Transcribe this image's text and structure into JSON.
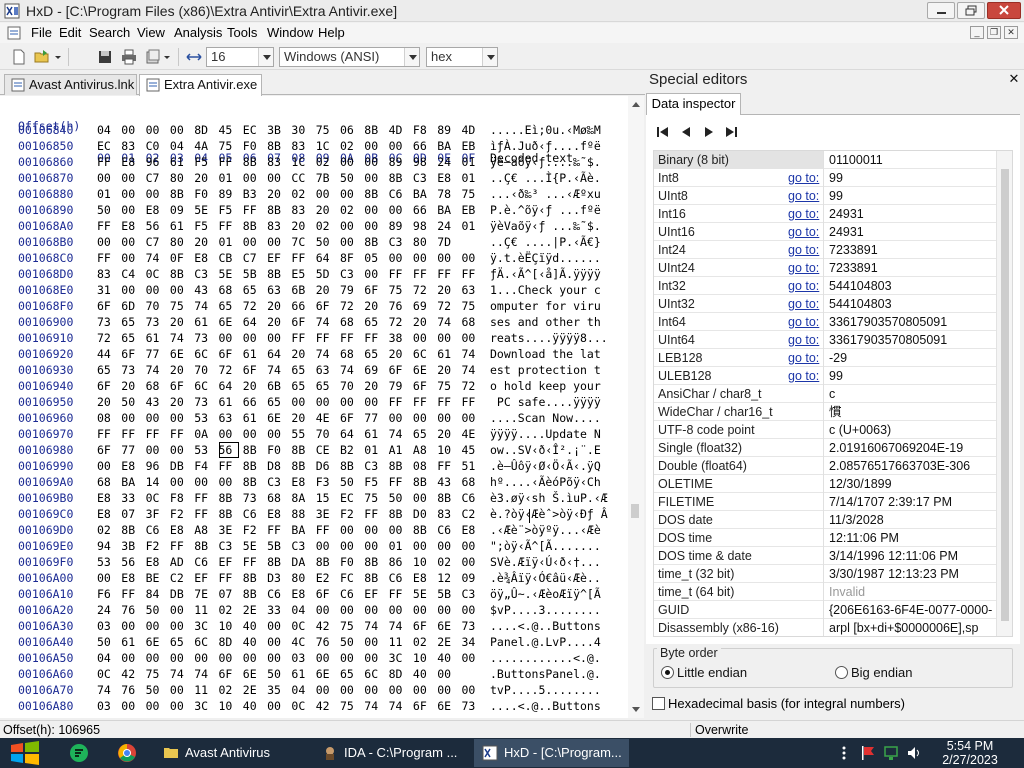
{
  "window": {
    "title": "HxD - [C:\\Program Files (x86)\\Extra Antivir\\Extra Antivir.exe]"
  },
  "menu": [
    "File",
    "Edit",
    "Search",
    "View",
    "Analysis",
    "Tools",
    "Window",
    "Help"
  ],
  "toolbar": {
    "bytes_per_row": "16",
    "charset": "Windows (ANSI)",
    "base": "hex"
  },
  "tabs": [
    {
      "label": "Avast Antivirus.lnk",
      "active": false
    },
    {
      "label": "Extra Antivir.exe",
      "active": true
    }
  ],
  "hex": {
    "offset_header": "Offset(h)",
    "column_headers": [
      "00",
      "01",
      "02",
      "03",
      "04",
      "05",
      "06",
      "07",
      "08",
      "09",
      "0A",
      "0B",
      "0C",
      "0D",
      "0E",
      "0F"
    ],
    "text_header": "Decoded text",
    "selected_cell": {
      "row": 20,
      "col": 5
    },
    "rows": [
      {
        "offset": "00106840",
        "bytes": [
          "04",
          "00",
          "00",
          "00",
          "8D",
          "45",
          "EC",
          "3B",
          "30",
          "75",
          "06",
          "8B",
          "4D",
          "F8",
          "89",
          "4D"
        ],
        "text": ".....Eì;0u.‹Mø‰M"
      },
      {
        "offset": "00106850",
        "bytes": [
          "EC",
          "83",
          "C0",
          "04",
          "4A",
          "75",
          "F0",
          "8B",
          "83",
          "1C",
          "02",
          "00",
          "00",
          "66",
          "BA",
          "EB"
        ],
        "text": "ìƒÀ.Juð‹ƒ....fºë"
      },
      {
        "offset": "00106860",
        "bytes": [
          "FF",
          "E8",
          "96",
          "61",
          "F5",
          "FF",
          "8B",
          "83",
          "1C",
          "02",
          "00",
          "00",
          "89",
          "98",
          "24",
          "01"
        ],
        "text": "ÿè–aõÿ‹ƒ....‰˜$."
      },
      {
        "offset": "00106870",
        "bytes": [
          "00",
          "00",
          "C7",
          "80",
          "20",
          "01",
          "00",
          "00",
          "CC",
          "7B",
          "50",
          "00",
          "8B",
          "C3",
          "E8",
          "01"
        ],
        "text": "..Ç€ ...Ì{P.‹Ãè."
      },
      {
        "offset": "00106880",
        "bytes": [
          "01",
          "00",
          "00",
          "8B",
          "F0",
          "89",
          "B3",
          "20",
          "02",
          "00",
          "00",
          "8B",
          "C6",
          "BA",
          "78",
          "75"
        ],
        "text": "...‹ð‰³ ...‹Æºxu"
      },
      {
        "offset": "00106890",
        "bytes": [
          "50",
          "00",
          "E8",
          "09",
          "5E",
          "F5",
          "FF",
          "8B",
          "83",
          "20",
          "02",
          "00",
          "00",
          "66",
          "BA",
          "EB"
        ],
        "text": "P.è.^õÿ‹ƒ ...fºë"
      },
      {
        "offset": "001068A0",
        "bytes": [
          "FF",
          "E8",
          "56",
          "61",
          "F5",
          "FF",
          "8B",
          "83",
          "20",
          "02",
          "00",
          "00",
          "89",
          "98",
          "24",
          "01"
        ],
        "text": "ÿèVaõÿ‹ƒ ...‰˜$."
      },
      {
        "offset": "001068B0",
        "bytes": [
          "00",
          "00",
          "C7",
          "80",
          "20",
          "01",
          "00",
          "00",
          "7C",
          "50",
          "00",
          "8B",
          "C3",
          "80",
          "7D"
        ],
        "text": "..Ç€ ....|P.‹Ã€}"
      },
      {
        "offset": "001068C0",
        "bytes": [
          "FF",
          "00",
          "74",
          "0F",
          "E8",
          "CB",
          "C7",
          "EF",
          "FF",
          "64",
          "8F",
          "05",
          "00",
          "00",
          "00",
          "00"
        ],
        "text": "ÿ.t.èËÇïÿd......"
      },
      {
        "offset": "001068D0",
        "bytes": [
          "83",
          "C4",
          "0C",
          "8B",
          "C3",
          "5E",
          "5B",
          "8B",
          "E5",
          "5D",
          "C3",
          "00",
          "FF",
          "FF",
          "FF",
          "FF"
        ],
        "text": "ƒÄ.‹Ã^[‹å]Ã.ÿÿÿÿ"
      },
      {
        "offset": "001068E0",
        "bytes": [
          "31",
          "00",
          "00",
          "00",
          "43",
          "68",
          "65",
          "63",
          "6B",
          "20",
          "79",
          "6F",
          "75",
          "72",
          "20",
          "63"
        ],
        "text": "1...Check your c"
      },
      {
        "offset": "001068F0",
        "bytes": [
          "6F",
          "6D",
          "70",
          "75",
          "74",
          "65",
          "72",
          "20",
          "66",
          "6F",
          "72",
          "20",
          "76",
          "69",
          "72",
          "75"
        ],
        "text": "omputer for viru"
      },
      {
        "offset": "00106900",
        "bytes": [
          "73",
          "65",
          "73",
          "20",
          "61",
          "6E",
          "64",
          "20",
          "6F",
          "74",
          "68",
          "65",
          "72",
          "20",
          "74",
          "68"
        ],
        "text": "ses and other th"
      },
      {
        "offset": "00106910",
        "bytes": [
          "72",
          "65",
          "61",
          "74",
          "73",
          "00",
          "00",
          "00",
          "FF",
          "FF",
          "FF",
          "FF",
          "38",
          "00",
          "00",
          "00"
        ],
        "text": "reats....ÿÿÿÿ8..."
      },
      {
        "offset": "00106920",
        "bytes": [
          "44",
          "6F",
          "77",
          "6E",
          "6C",
          "6F",
          "61",
          "64",
          "20",
          "74",
          "68",
          "65",
          "20",
          "6C",
          "61",
          "74"
        ],
        "text": "Download the lat"
      },
      {
        "offset": "00106930",
        "bytes": [
          "65",
          "73",
          "74",
          "20",
          "70",
          "72",
          "6F",
          "74",
          "65",
          "63",
          "74",
          "69",
          "6F",
          "6E",
          "20",
          "74"
        ],
        "text": "est protection t"
      },
      {
        "offset": "00106940",
        "bytes": [
          "6F",
          "20",
          "68",
          "6F",
          "6C",
          "64",
          "20",
          "6B",
          "65",
          "65",
          "70",
          "20",
          "79",
          "6F",
          "75",
          "72"
        ],
        "text": "o hold keep your"
      },
      {
        "offset": "00106950",
        "bytes": [
          "20",
          "50",
          "43",
          "20",
          "73",
          "61",
          "66",
          "65",
          "00",
          "00",
          "00",
          "00",
          "FF",
          "FF",
          "FF",
          "FF"
        ],
        "text": " PC safe....ÿÿÿÿ"
      },
      {
        "offset": "00106960",
        "bytes": [
          "08",
          "00",
          "00",
          "00",
          "53",
          "63",
          "61",
          "6E",
          "20",
          "4E",
          "6F",
          "77",
          "00",
          "00",
          "00",
          "00"
        ],
        "text": "....Scan Now...."
      },
      {
        "offset": "00106970",
        "bytes": [
          "FF",
          "FF",
          "FF",
          "FF",
          "0A",
          "00",
          "00",
          "00",
          "55",
          "70",
          "64",
          "61",
          "74",
          "65",
          "20",
          "4E"
        ],
        "text": "ÿÿÿÿ....Update N"
      },
      {
        "offset": "00106980",
        "bytes": [
          "6F",
          "77",
          "00",
          "00",
          "53",
          "56",
          "8B",
          "F0",
          "8B",
          "CE",
          "B2",
          "01",
          "A1",
          "A8",
          "10",
          "45"
        ],
        "text": "ow..SV‹ð‹Î².¡¨.E"
      },
      {
        "offset": "00106990",
        "bytes": [
          "00",
          "E8",
          "96",
          "DB",
          "F4",
          "FF",
          "8B",
          "D8",
          "8B",
          "D6",
          "8B",
          "C3",
          "8B",
          "08",
          "FF",
          "51"
        ],
        "text": ".è–Ûôÿ‹Ø‹Ö‹Ã‹.ÿQ"
      },
      {
        "offset": "001069A0",
        "bytes": [
          "68",
          "BA",
          "14",
          "00",
          "00",
          "00",
          "8B",
          "C3",
          "E8",
          "F3",
          "50",
          "F5",
          "FF",
          "8B",
          "43",
          "68"
        ],
        "text": "hº....‹ÃèóPõÿ‹Ch"
      },
      {
        "offset": "001069B0",
        "bytes": [
          "E8",
          "33",
          "0C",
          "F8",
          "FF",
          "8B",
          "73",
          "68",
          "8A",
          "15",
          "EC",
          "75",
          "50",
          "00",
          "8B",
          "C6"
        ],
        "text": "è3.øÿ‹sh Š.ìuP.‹Æ"
      },
      {
        "offset": "001069C0",
        "bytes": [
          "E8",
          "07",
          "3F",
          "F2",
          "FF",
          "8B",
          "C6",
          "E8",
          "88",
          "3E",
          "F2",
          "FF",
          "8B",
          "D0",
          "83",
          "C2"
        ],
        "text": "è.?òÿ‹Æèˆ>òÿ‹Ðƒ Â"
      },
      {
        "offset": "001069D0",
        "bytes": [
          "02",
          "8B",
          "C6",
          "E8",
          "A8",
          "3E",
          "F2",
          "FF",
          "BA",
          "FF",
          "00",
          "00",
          "00",
          "8B",
          "C6",
          "E8"
        ],
        "text": ".‹Æè¨>òÿºÿ...‹Æè"
      },
      {
        "offset": "001069E0",
        "bytes": [
          "94",
          "3B",
          "F2",
          "FF",
          "8B",
          "C3",
          "5E",
          "5B",
          "C3",
          "00",
          "00",
          "00",
          "01",
          "00",
          "00",
          "00"
        ],
        "text": "\";òÿ‹Ã^[Ã......."
      },
      {
        "offset": "001069F0",
        "bytes": [
          "53",
          "56",
          "E8",
          "AD",
          "C6",
          "EF",
          "FF",
          "8B",
          "DA",
          "8B",
          "F0",
          "8B",
          "86",
          "10",
          "02",
          "00"
        ],
        "text": "SVè.Æïÿ‹Ú‹ð‹†..."
      },
      {
        "offset": "00106A00",
        "bytes": [
          "00",
          "E8",
          "BE",
          "C2",
          "EF",
          "FF",
          "8B",
          "D3",
          "80",
          "E2",
          "FC",
          "8B",
          "C6",
          "E8",
          "12",
          "09"
        ],
        "text": ".è¾Âïÿ‹Ó€âü‹Æè.."
      },
      {
        "offset": "00106A10",
        "bytes": [
          "F6",
          "FF",
          "84",
          "DB",
          "7E",
          "07",
          "8B",
          "C6",
          "E8",
          "6F",
          "C6",
          "EF",
          "FF",
          "5E",
          "5B",
          "C3"
        ],
        "text": "öÿ„Û~.‹ÆèoÆïÿ^[Ã"
      },
      {
        "offset": "00106A20",
        "bytes": [
          "24",
          "76",
          "50",
          "00",
          "11",
          "02",
          "2E",
          "33",
          "04",
          "00",
          "00",
          "00",
          "00",
          "00",
          "00",
          "00"
        ],
        "text": "$vP....3........"
      },
      {
        "offset": "00106A30",
        "bytes": [
          "03",
          "00",
          "00",
          "00",
          "3C",
          "10",
          "40",
          "00",
          "0C",
          "42",
          "75",
          "74",
          "74",
          "6F",
          "6E",
          "73"
        ],
        "text": "....<.@..Buttons"
      },
      {
        "offset": "00106A40",
        "bytes": [
          "50",
          "61",
          "6E",
          "65",
          "6C",
          "8D",
          "40",
          "00",
          "4C",
          "76",
          "50",
          "00",
          "11",
          "02",
          "2E",
          "34"
        ],
        "text": "Panel.@.LvP....4"
      },
      {
        "offset": "00106A50",
        "bytes": [
          "04",
          "00",
          "00",
          "00",
          "00",
          "00",
          "00",
          "00",
          "03",
          "00",
          "00",
          "00",
          "3C",
          "10",
          "40",
          "00"
        ],
        "text": "............<.@."
      },
      {
        "offset": "00106A60",
        "bytes": [
          "0C",
          "42",
          "75",
          "74",
          "74",
          "6F",
          "6E",
          "50",
          "61",
          "6E",
          "65",
          "6C",
          "8D",
          "40",
          "00"
        ],
        "text": ".ButtonsPanel.@."
      },
      {
        "offset": "00106A70",
        "bytes": [
          "74",
          "76",
          "50",
          "00",
          "11",
          "02",
          "2E",
          "35",
          "04",
          "00",
          "00",
          "00",
          "00",
          "00",
          "00",
          "00"
        ],
        "text": "tvP....5........"
      },
      {
        "offset": "00106A80",
        "bytes": [
          "03",
          "00",
          "00",
          "00",
          "3C",
          "10",
          "40",
          "00",
          "0C",
          "42",
          "75",
          "74",
          "74",
          "6F",
          "6E",
          "73"
        ],
        "text": "....<.@..Buttons"
      }
    ]
  },
  "special_editors": {
    "title": "Special editors",
    "tab": "Data inspector",
    "goto_label": "go to:",
    "rows": [
      {
        "label": "Binary (8 bit)",
        "goto": false,
        "value": "01100011"
      },
      {
        "label": "Int8",
        "goto": true,
        "value": "99"
      },
      {
        "label": "UInt8",
        "goto": true,
        "value": "99"
      },
      {
        "label": "Int16",
        "goto": true,
        "value": "24931"
      },
      {
        "label": "UInt16",
        "goto": true,
        "value": "24931"
      },
      {
        "label": "Int24",
        "goto": true,
        "value": "7233891"
      },
      {
        "label": "UInt24",
        "goto": true,
        "value": "7233891"
      },
      {
        "label": "Int32",
        "goto": true,
        "value": "544104803"
      },
      {
        "label": "UInt32",
        "goto": true,
        "value": "544104803"
      },
      {
        "label": "Int64",
        "goto": true,
        "value": "33617903570805091"
      },
      {
        "label": "UInt64",
        "goto": true,
        "value": "33617903570805091"
      },
      {
        "label": "LEB128",
        "goto": true,
        "value": "-29"
      },
      {
        "label": "ULEB128",
        "goto": true,
        "value": "99"
      },
      {
        "label": "AnsiChar / char8_t",
        "goto": false,
        "value": "c"
      },
      {
        "label": "WideChar / char16_t",
        "goto": false,
        "value": "慣"
      },
      {
        "label": "UTF-8 code point",
        "goto": false,
        "value": "c (U+0063)"
      },
      {
        "label": "Single (float32)",
        "goto": false,
        "value": "2.01916067069204E-19"
      },
      {
        "label": "Double (float64)",
        "goto": false,
        "value": "2.08576517663703E-306"
      },
      {
        "label": "OLETIME",
        "goto": false,
        "value": "12/30/1899"
      },
      {
        "label": "FILETIME",
        "goto": false,
        "value": "7/14/1707 2:39:17 PM"
      },
      {
        "label": "DOS date",
        "goto": false,
        "value": "11/3/2028"
      },
      {
        "label": "DOS time",
        "goto": false,
        "value": "12:11:06 PM"
      },
      {
        "label": "DOS time & date",
        "goto": false,
        "value": "3/14/1996 12:11:06 PM"
      },
      {
        "label": "time_t (32 bit)",
        "goto": false,
        "value": "3/30/1987 12:13:23 PM"
      },
      {
        "label": "time_t (64 bit)",
        "goto": false,
        "value": "Invalid"
      },
      {
        "label": "GUID",
        "goto": false,
        "value": "{206E6163-6F4E-0077-0000-"
      },
      {
        "label": "Disassembly (x86-16)",
        "goto": false,
        "value": "arpl [bx+di+$0000006E],sp"
      }
    ],
    "byte_order_label": "Byte order",
    "little_endian": "Little endian",
    "big_endian": "Big endian",
    "hex_basis": "Hexadecimal basis (for integral numbers)"
  },
  "status": {
    "offset": "Offset(h): 106965",
    "mode": "Overwrite"
  },
  "taskbar": {
    "tasks": [
      "Avast Antivirus",
      "IDA - C:\\Program ...",
      "HxD - [C:\\Program..."
    ],
    "time": "5:54 PM",
    "date": "2/27/2023"
  },
  "colors": {
    "hex_header": "#1b2a93",
    "link": "#1c36a8",
    "taskbar": "#1c2b3c",
    "close_button": "#c9473d"
  }
}
